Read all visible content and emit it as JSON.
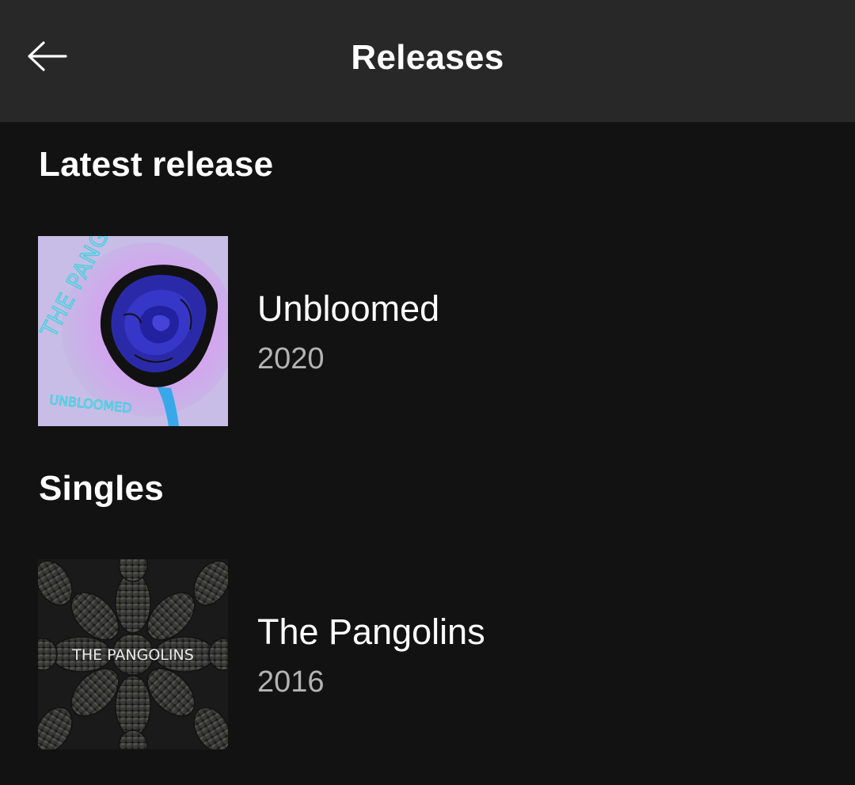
{
  "header": {
    "title": "Releases",
    "back_icon": "arrow-left-icon"
  },
  "latest": {
    "section_title": "Latest release",
    "item": {
      "name": "Unbloomed",
      "year": "2020",
      "cover": {
        "icon": "album-cover-unbloomed",
        "text_band": "THE PANGOLINS",
        "text_bottom": "UNBLOOMED",
        "bg_color": "#c9bbe6",
        "rose_color": "#2f2fb0",
        "text_color": "#3ad3e0"
      }
    }
  },
  "singles": {
    "section_title": "Singles",
    "items": [
      {
        "name": "The Pangolins",
        "year": "2016",
        "cover": {
          "icon": "album-cover-the-pangolins",
          "text": "THE PANGOLINS",
          "bg_color": "#2b2b2b"
        }
      }
    ]
  }
}
